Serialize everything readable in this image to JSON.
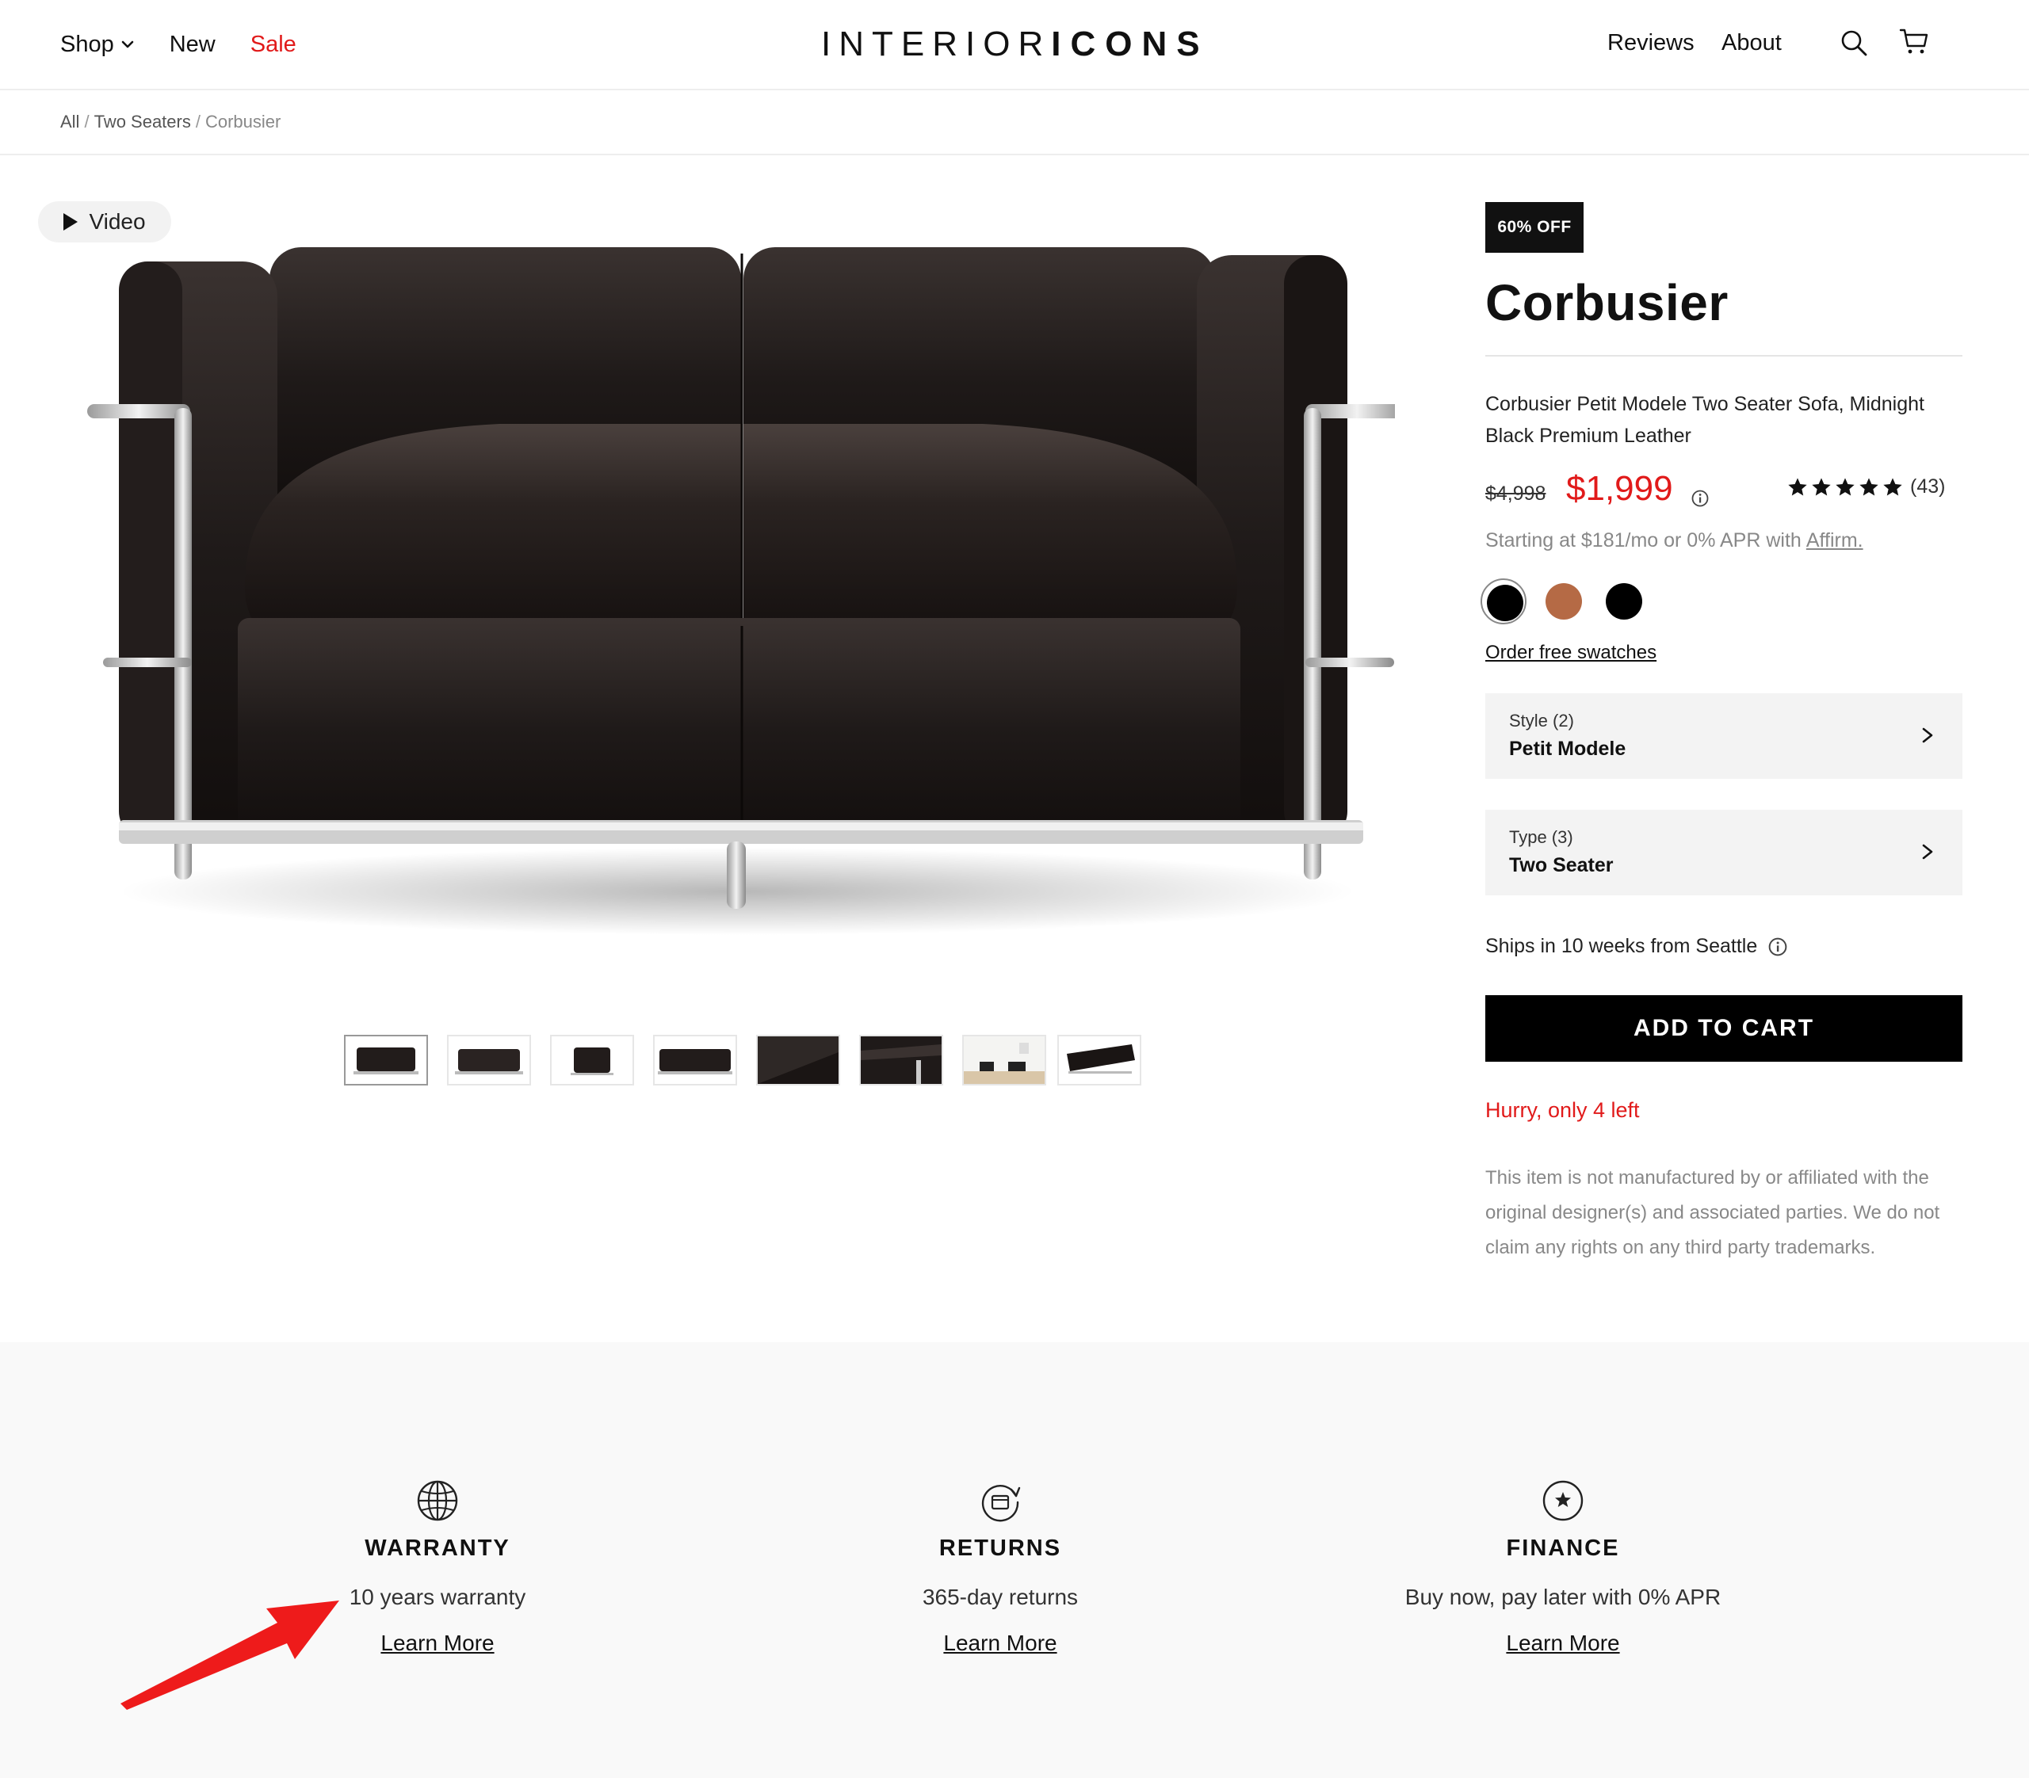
{
  "header": {
    "nav_left": {
      "shop": "Shop",
      "new": "New",
      "sale": "Sale"
    },
    "logo": {
      "part1": "INTERIOR",
      "part2": "ICONS"
    },
    "nav_right": {
      "reviews": "Reviews",
      "about": "About"
    },
    "icons": [
      "chevron-down-icon",
      "search-icon",
      "cart-icon"
    ]
  },
  "breadcrumb": {
    "all": "All",
    "category": "Two Seaters",
    "current": "Corbusier",
    "sep": "/"
  },
  "gallery": {
    "video_label": "Video",
    "thumbnail_count": 8
  },
  "product": {
    "badge": "60% OFF",
    "title": "Corbusier",
    "description": "Corbusier Petit Modele Two Seater Sofa, Midnight Black Premium Leather",
    "price_old": "$4,998",
    "price_new": "$1,999",
    "rating_stars": 5,
    "rating_count": "(43)",
    "financing_text": "Starting at $181/mo or 0% APR with",
    "financing_link": "Affirm.",
    "swatches": [
      {
        "name": "black-leather",
        "color": "#000000",
        "selected": true
      },
      {
        "name": "cognac-leather",
        "color": "#b56a45",
        "selected": false
      },
      {
        "name": "black",
        "color": "#000000",
        "selected": false
      }
    ],
    "order_swatches": "Order free swatches",
    "options": [
      {
        "label": "Style (2)",
        "value": "Petit Modele"
      },
      {
        "label": "Type (3)",
        "value": "Two Seater"
      }
    ],
    "ships": "Ships in 10 weeks from Seattle",
    "add_to_cart": "ADD TO CART",
    "hurry": "Hurry, only 4 left",
    "disclaimer": "This item is not manufactured by or affiliated with the original designer(s) and associated parties. We do not claim any rights on any third party trademarks."
  },
  "features": [
    {
      "icon": "globe-icon",
      "title": "WARRANTY",
      "subtitle": "10 years warranty",
      "link": "Learn More"
    },
    {
      "icon": "returns-icon",
      "title": "RETURNS",
      "subtitle": "365-day returns",
      "link": "Learn More"
    },
    {
      "icon": "star-circle-icon",
      "title": "FINANCE",
      "subtitle": "Buy now, pay later with 0% APR",
      "link": "Learn More"
    }
  ],
  "colors": {
    "accent_red": "#e11a1a",
    "cta_black": "#000000",
    "option_bg": "#f3f3f3",
    "features_bg": "#f9f9f9"
  },
  "annotation": {
    "icon": "red-arrow-annotation"
  }
}
